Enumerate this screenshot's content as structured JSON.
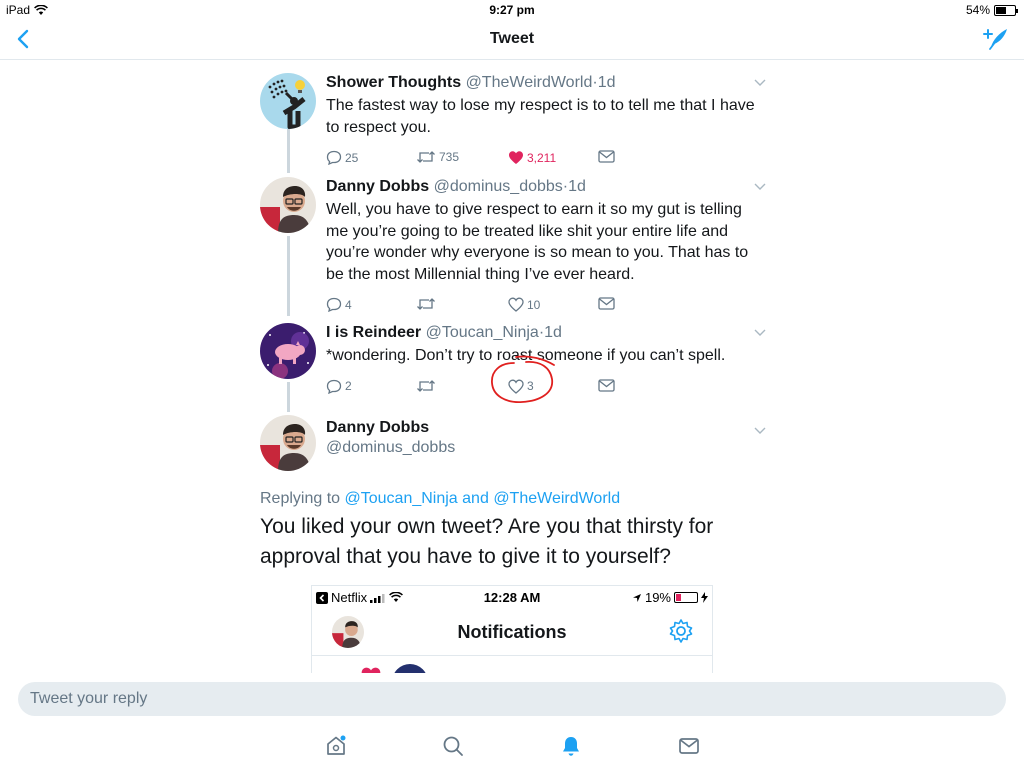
{
  "status_bar": {
    "device": "iPad",
    "time": "9:27 pm",
    "battery": "54%",
    "battery_level": 0.54
  },
  "nav": {
    "title": "Tweet"
  },
  "thread": [
    {
      "name": "Shower Thoughts",
      "handle": "@TheWeirdWorld",
      "separator": "·",
      "time": "1d",
      "text": "The fastest way to lose my respect is to to tell me that I have to respect you.",
      "replies": "25",
      "retweets": "735",
      "likes": "3,211",
      "liked": true
    },
    {
      "name": "Danny Dobbs",
      "handle": "@dominus_dobbs",
      "separator": "·",
      "time": "1d",
      "text": "Well, you have to give respect to earn it so my gut is telling me you’re going to be treated like shit your entire life and you’re  wonder why everyone is so mean to you. That has to be the most Millennial thing I’ve ever heard.",
      "replies": "4",
      "retweets": "",
      "likes": "10",
      "liked": false
    },
    {
      "name": "I is Reindeer",
      "handle": "@Toucan_Ninja",
      "separator": "·",
      "time": "1d",
      "text": "*wondering. Don’t try to roast someone if you can’t spell.",
      "replies": "2",
      "retweets": "",
      "likes": "3",
      "liked": false
    }
  ],
  "main_tweet": {
    "name": "Danny Dobbs",
    "handle": "@dominus_dobbs",
    "replying_prefix": "Replying to",
    "replying_user1": "@Toucan_Ninja",
    "replying_and": "and",
    "replying_user2": "@TheWeirdWorld",
    "text": "You liked your own tweet? Are you that thirsty for approval that you have to give it to yourself?"
  },
  "embedded_screenshot": {
    "carrier": "Netflix",
    "time": "12:28 AM",
    "battery": "19%",
    "title": "Notifications"
  },
  "reply": {
    "placeholder": "Tweet your reply"
  },
  "colors": {
    "accent": "#1da1f2",
    "like": "#e0245e",
    "secondary_text": "#657786",
    "annotation": "#e0201f"
  }
}
